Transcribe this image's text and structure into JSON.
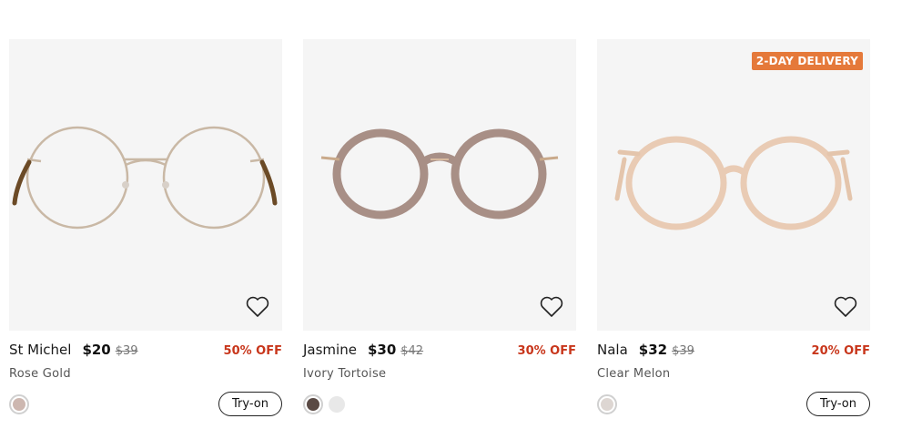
{
  "products": [
    {
      "name": "St Michel",
      "price": "$20",
      "old_price": "$39",
      "discount": "50% OFF",
      "color_name": "Rose Gold",
      "badge": "",
      "swatches": [
        "#cdb7b0"
      ],
      "try_on": "Try-on",
      "frame_color": "#c9b8a5",
      "temple_color": "#6b4a26"
    },
    {
      "name": "Jasmine",
      "price": "$30",
      "old_price": "$42",
      "discount": "30% OFF",
      "color_name": "Ivory Tortoise",
      "badge": "",
      "swatches": [
        "#5a4a44",
        "#e8e8e8"
      ],
      "try_on": "",
      "frame_color": "#a88f86",
      "temple_color": "#c9a98a"
    },
    {
      "name": "Nala",
      "price": "$32",
      "old_price": "$39",
      "discount": "20% OFF",
      "color_name": "Clear Melon",
      "badge": "2-DAY DELIVERY",
      "swatches": [
        "#ddd6d2"
      ],
      "try_on": "Try-on",
      "frame_color": "#e9cbb4",
      "temple_color": "#e4c5ac"
    }
  ]
}
